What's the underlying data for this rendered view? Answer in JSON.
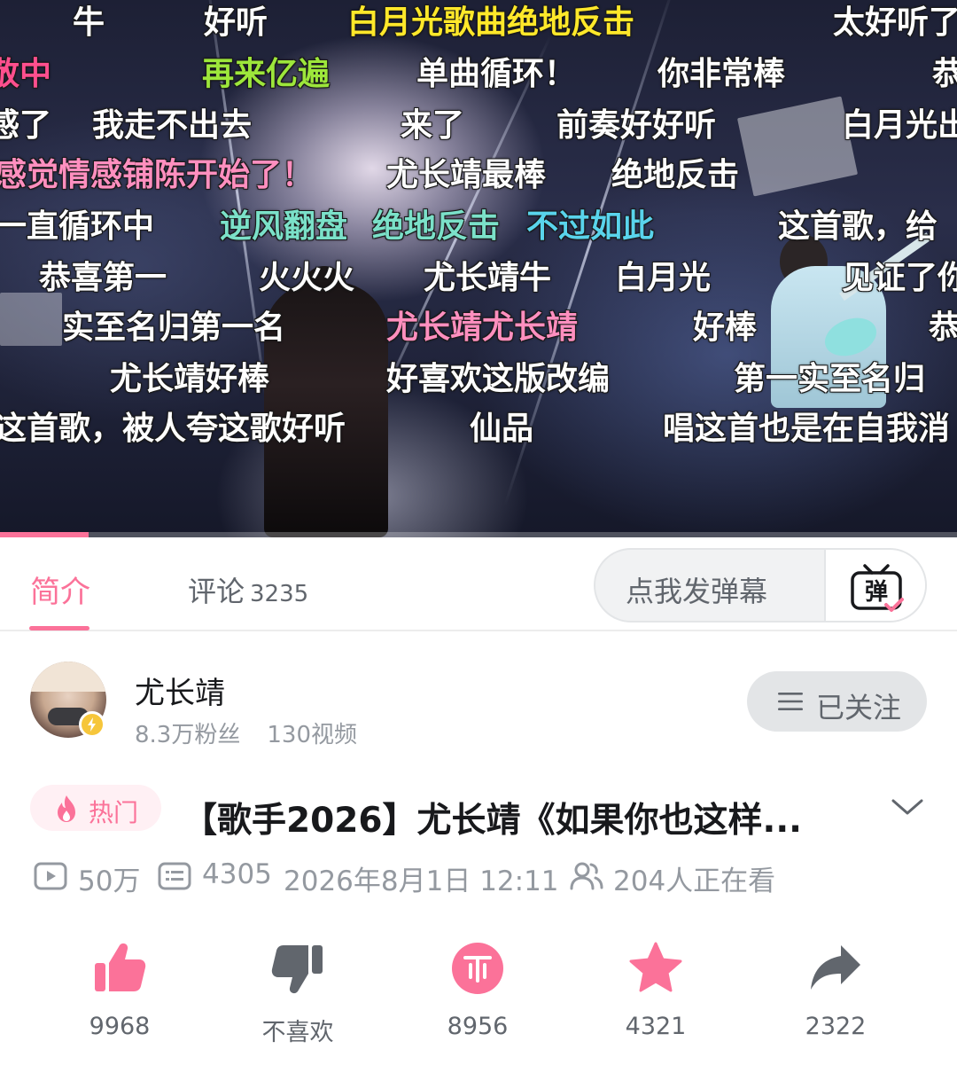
{
  "video": {
    "progress": 0.093,
    "danmaku": [
      {
        "text": "牛",
        "color": "white"
      },
      {
        "text": "好听",
        "color": "white"
      },
      {
        "text": "白月光歌曲绝地反击",
        "color": "yellow"
      },
      {
        "text": "太好听了",
        "color": "white"
      },
      {
        "text": "敬中",
        "color": "pink"
      },
      {
        "text": "再来亿遍",
        "color": "green"
      },
      {
        "text": "单曲循环！",
        "color": "white"
      },
      {
        "text": "你非常棒",
        "color": "white"
      },
      {
        "text": "恭",
        "color": "white"
      },
      {
        "text": "感了",
        "color": "white"
      },
      {
        "text": "我走不出去",
        "color": "white"
      },
      {
        "text": "来了",
        "color": "white"
      },
      {
        "text": "前奏好好听",
        "color": "white"
      },
      {
        "text": "白月光出",
        "color": "white"
      },
      {
        "text": "感觉情感铺陈开始了！",
        "color": "lightpink"
      },
      {
        "text": "尤长靖最棒",
        "color": "white"
      },
      {
        "text": "绝地反击",
        "color": "white"
      },
      {
        "text": "一直循环中",
        "color": "white"
      },
      {
        "text": "逆风翻盘",
        "color": "lightgreen"
      },
      {
        "text": "绝地反击",
        "color": "lightgreen"
      },
      {
        "text": "不过如此",
        "color": "cyan"
      },
      {
        "text": "这首歌，给",
        "color": "white"
      },
      {
        "text": "恭喜第一",
        "color": "white"
      },
      {
        "text": "火火火",
        "color": "white"
      },
      {
        "text": "尤长靖牛",
        "color": "white"
      },
      {
        "text": "白月光",
        "color": "white"
      },
      {
        "text": "见证了你",
        "color": "white"
      },
      {
        "text": "实至名归第一名",
        "color": "white"
      },
      {
        "text": "尤长靖尤长靖",
        "color": "lightpink"
      },
      {
        "text": "好棒",
        "color": "white"
      },
      {
        "text": "恭",
        "color": "white"
      },
      {
        "text": "尤长靖好棒",
        "color": "white"
      },
      {
        "text": "好喜欢这版改编",
        "color": "white"
      },
      {
        "text": "第一实至名归",
        "color": "white"
      },
      {
        "text": "这首歌，被人夸这歌好听",
        "color": "white"
      },
      {
        "text": "仙品",
        "color": "white"
      },
      {
        "text": "唱这首也是在自我消",
        "color": "white"
      }
    ]
  },
  "tabs": {
    "intro": "简介",
    "comments": "评论",
    "comments_count": "3235",
    "danmaku_placeholder": "点我发弹幕",
    "danmaku_button_glyph": "弹"
  },
  "uploader": {
    "name": "尤长靖",
    "fans": "8.3万粉丝",
    "videos": "130视频",
    "follow_label": "已关注"
  },
  "title": {
    "hot_badge": "热门",
    "text": "【歌手2026】尤长靖《如果你也这样..."
  },
  "meta": {
    "views": "50万",
    "danmaku_count": "4305",
    "date": "2026年8月1日 12:11",
    "watching": "204人正在看"
  },
  "actions": {
    "like": "9968",
    "dislike": "不喜欢",
    "coin": "8956",
    "favorite": "4321",
    "share": "2322"
  },
  "colors": {
    "brand_pink": "#fb7299",
    "text_secondary": "#61666d",
    "text_tertiary": "#9499a0",
    "icon_gray": "#61666d"
  },
  "icons": [
    "play-count-icon",
    "danmaku-count-icon",
    "watching-icon",
    "fire-icon",
    "menu-icon",
    "chevron-down-icon",
    "danmaku-send-icon",
    "like-icon",
    "dislike-icon",
    "coin-icon",
    "favorite-icon",
    "share-icon",
    "lightning-badge-icon"
  ]
}
